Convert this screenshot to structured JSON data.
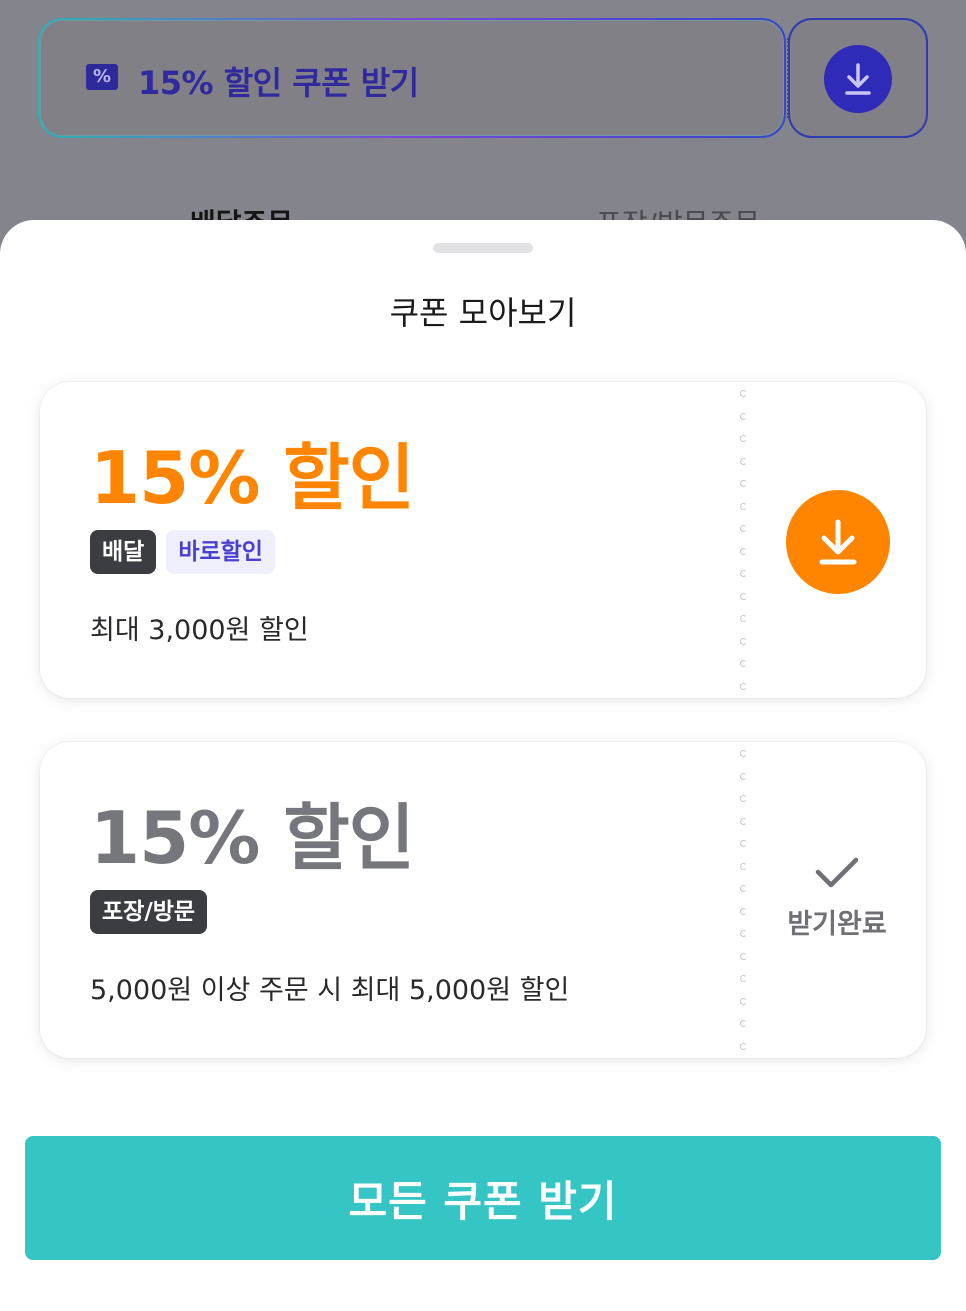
{
  "background": {
    "banner": {
      "text": "15% 할인 쿠폰 받기",
      "icon": "percent-ticket-icon",
      "download_icon": "download-icon"
    },
    "tabs": [
      {
        "label": "배달주문"
      },
      {
        "label": "포장/방문주문"
      }
    ]
  },
  "sheet": {
    "title": "쿠폰 모아보기",
    "coupons": [
      {
        "amount": "15% 할인",
        "tags": [
          "배달",
          "바로할인"
        ],
        "description": "최대 3,000원 할인",
        "action": "download",
        "action_icon": "download-icon",
        "accent": "#FF8500"
      },
      {
        "amount": "15% 할인",
        "tags": [
          "포장/방문"
        ],
        "description": "5,000원 이상 주문 시 최대 5,000원 할인",
        "status_label": "받기완료",
        "status_icon": "check-icon"
      }
    ],
    "cta_label": "모든 쿠폰 받기",
    "colors": {
      "primary": "#36C5C5",
      "accent": "#FF8500",
      "tag_purple": "#4B3FCF"
    }
  }
}
